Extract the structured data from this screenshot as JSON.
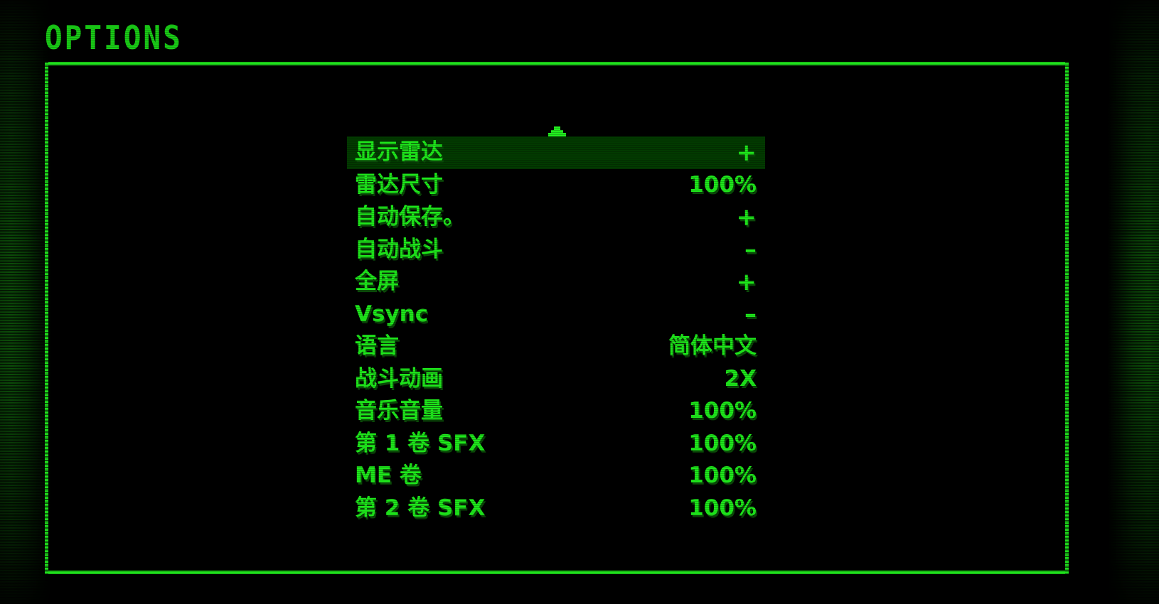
{
  "title": "OPTIONS",
  "colors": {
    "text_green": "#1ee81b",
    "frame_green": "#1fe01c",
    "highlight_bg": "#023a00",
    "shadow_green": "#0a4a08",
    "background": "#000000"
  },
  "menu": {
    "selected_index": 0,
    "selector_icon": "caret-up-icon",
    "rows": [
      {
        "label": "显示雷达",
        "value": "+"
      },
      {
        "label": "雷达尺寸",
        "value": "100%"
      },
      {
        "label": "自动保存。",
        "value": "+"
      },
      {
        "label": "自动战斗",
        "value": "–"
      },
      {
        "label": "全屏",
        "value": "+"
      },
      {
        "label": "Vsync",
        "value": "–"
      },
      {
        "label": "语言",
        "value": "简体中文"
      },
      {
        "label": "战斗动画",
        "value": "2X"
      },
      {
        "label": "音乐音量",
        "value": "100%"
      },
      {
        "label": "第 1 卷 SFX",
        "value": "100%"
      },
      {
        "label": "ME 卷",
        "value": "100%"
      },
      {
        "label": "第 2 卷 SFX",
        "value": "100%"
      }
    ]
  }
}
